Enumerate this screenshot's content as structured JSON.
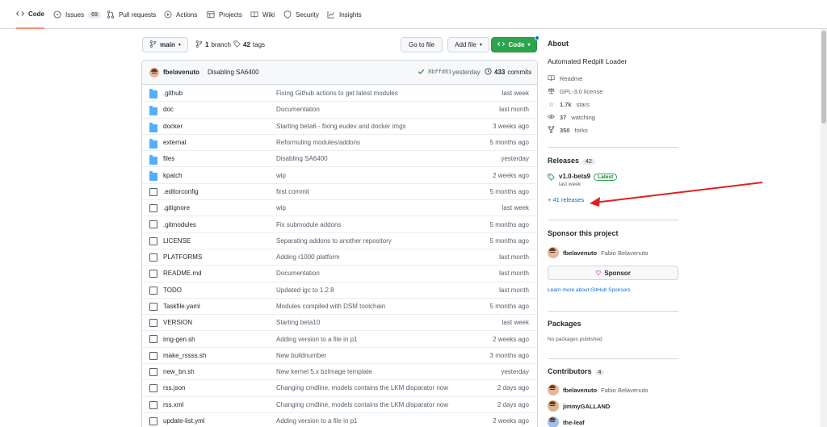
{
  "nav": {
    "tabs": [
      {
        "label": "Code",
        "icon": "code-icon",
        "active": true
      },
      {
        "label": "Issues",
        "icon": "issue-icon",
        "count": "69"
      },
      {
        "label": "Pull requests",
        "icon": "pull-request-icon"
      },
      {
        "label": "Actions",
        "icon": "play-icon"
      },
      {
        "label": "Projects",
        "icon": "table-icon"
      },
      {
        "label": "Wiki",
        "icon": "book-icon"
      },
      {
        "label": "Security",
        "icon": "shield-icon"
      },
      {
        "label": "Insights",
        "icon": "graph-icon"
      }
    ]
  },
  "filebar": {
    "branch": "main",
    "branches_count": "1",
    "branches_label": "branch",
    "tags_count": "42",
    "tags_label": "tags",
    "go_to_file": "Go to file",
    "add_file": "Add file",
    "code": "Code"
  },
  "commit": {
    "author": "fbelavenuto",
    "message": "Disabling SA6400",
    "hash": "8bffd61",
    "time": "yesterday",
    "commits_count": "433",
    "commits_label": "commits"
  },
  "files": [
    {
      "type": "dir",
      "name": ".github",
      "msg": "Fixing Github actions to get latest modules",
      "age": "last week"
    },
    {
      "type": "dir",
      "name": "doc",
      "msg": "Documentation",
      "age": "last month"
    },
    {
      "type": "dir",
      "name": "docker",
      "msg": "Starting beta6 - fixing eudev and docker imgs",
      "age": "3 weeks ago"
    },
    {
      "type": "dir",
      "name": "external",
      "msg": "Reformuling modules/addons",
      "age": "5 months ago"
    },
    {
      "type": "dir",
      "name": "files",
      "msg": "Disabling SA6400",
      "age": "yesterday"
    },
    {
      "type": "dir",
      "name": "kpatch",
      "msg": "wip",
      "age": "2 weeks ago"
    },
    {
      "type": "file",
      "name": ".editorconfig",
      "msg": "first commit",
      "age": "5 months ago"
    },
    {
      "type": "file",
      "name": ".gitignore",
      "msg": "wip",
      "age": "last week"
    },
    {
      "type": "file",
      "name": ".gitmodules",
      "msg": "Fix submodule addons",
      "age": "5 months ago"
    },
    {
      "type": "file",
      "name": "LICENSE",
      "msg": "Separating addons to another repository",
      "age": "5 months ago"
    },
    {
      "type": "file",
      "name": "PLATFORMS",
      "msg": "Adding r1000 platform",
      "age": "last month"
    },
    {
      "type": "file",
      "name": "README.md",
      "msg": "Documentation",
      "age": "last month"
    },
    {
      "type": "file",
      "name": "TODO",
      "msg": "Updated igc to 1.2.8",
      "age": "last month"
    },
    {
      "type": "file",
      "name": "Taskfile.yaml",
      "msg": "Modules compiled with DSM toolchain",
      "age": "5 months ago"
    },
    {
      "type": "file",
      "name": "VERSION",
      "msg": "Starting beta10",
      "age": "last week"
    },
    {
      "type": "file",
      "name": "img-gen.sh",
      "msg": "Adding version to a file in p1",
      "age": "2 weeks ago"
    },
    {
      "type": "file",
      "name": "make_rssss.sh",
      "msg": "New buildnumber",
      "age": "3 months ago"
    },
    {
      "type": "file",
      "name": "new_bn.sh",
      "msg": "New kernel 5.x bzImage template",
      "age": "yesterday"
    },
    {
      "type": "file",
      "name": "rss.json",
      "msg": "Changing cmdline, models contains the LKM disparator now",
      "age": "2 days ago"
    },
    {
      "type": "file",
      "name": "rss.xml",
      "msg": "Changing cmdline, models contains the LKM disparator now",
      "age": "2 days ago"
    },
    {
      "type": "file",
      "name": "update-list.yml",
      "msg": "Adding version to a file in p1",
      "age": "2 weeks ago"
    }
  ],
  "about": {
    "title": "About",
    "description": "Automated Redpill Loader",
    "readme": "Readme",
    "license": "GPL-3.0 license",
    "stars": "1.7k",
    "stars_label": "stars",
    "watching": "37",
    "watching_label": "watching",
    "forks": "350",
    "forks_label": "forks"
  },
  "releases": {
    "title": "Releases",
    "count": "42",
    "latest_tag": "v1.0-beta9",
    "latest_badge": "Latest",
    "latest_time": "last week",
    "more": "+ 41 releases"
  },
  "sponsor": {
    "title": "Sponsor this project",
    "user": "fbelavenuto",
    "user_full": "Fabio Belavenuto",
    "button": "Sponsor",
    "learn": "Learn more about GitHub Sponsors"
  },
  "packages": {
    "title": "Packages",
    "text": "No packages published"
  },
  "contributors": {
    "title": "Contributors",
    "count": "4",
    "people": [
      {
        "login": "fbelavenuto",
        "name": "Fabio Belavenuto"
      },
      {
        "login": "jimmyGALLAND",
        "name": ""
      },
      {
        "login": "the-leaf",
        "name": ""
      }
    ]
  },
  "colors": {
    "accent_green": "#2da44e",
    "link_blue": "#0969da",
    "folder_blue": "#54aeff",
    "annotation_red": "#e02020"
  }
}
